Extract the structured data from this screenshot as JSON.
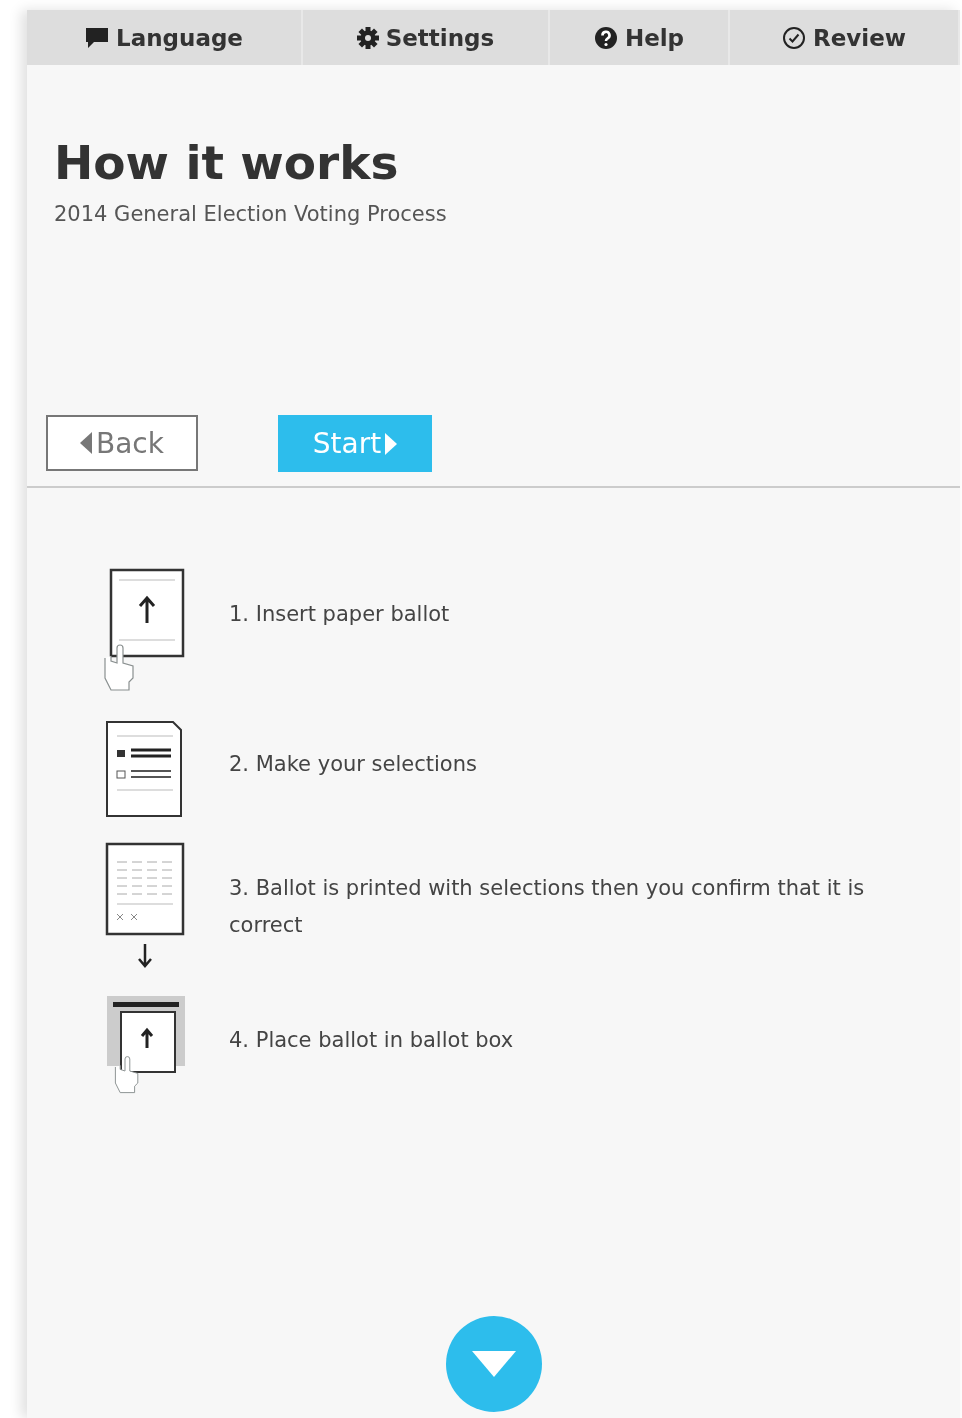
{
  "tabs": [
    {
      "label": "Language",
      "kind": "speech"
    },
    {
      "label": "Settings",
      "kind": "gear"
    },
    {
      "label": "Help",
      "kind": "question"
    },
    {
      "label": "Review",
      "kind": "check"
    }
  ],
  "header": {
    "title": "How it works",
    "subtitle": "2014 General Election Voting Process"
  },
  "buttons": {
    "back": "Back",
    "start": "Start"
  },
  "steps": [
    {
      "kind": "insert",
      "text": "1. Insert paper ballot"
    },
    {
      "kind": "select",
      "text": "2. Make your selections"
    },
    {
      "kind": "print",
      "text": "3. Ballot is printed with selections then you confirm that it is correct"
    },
    {
      "kind": "box",
      "text": "4. Place ballot in ballot box"
    }
  ]
}
